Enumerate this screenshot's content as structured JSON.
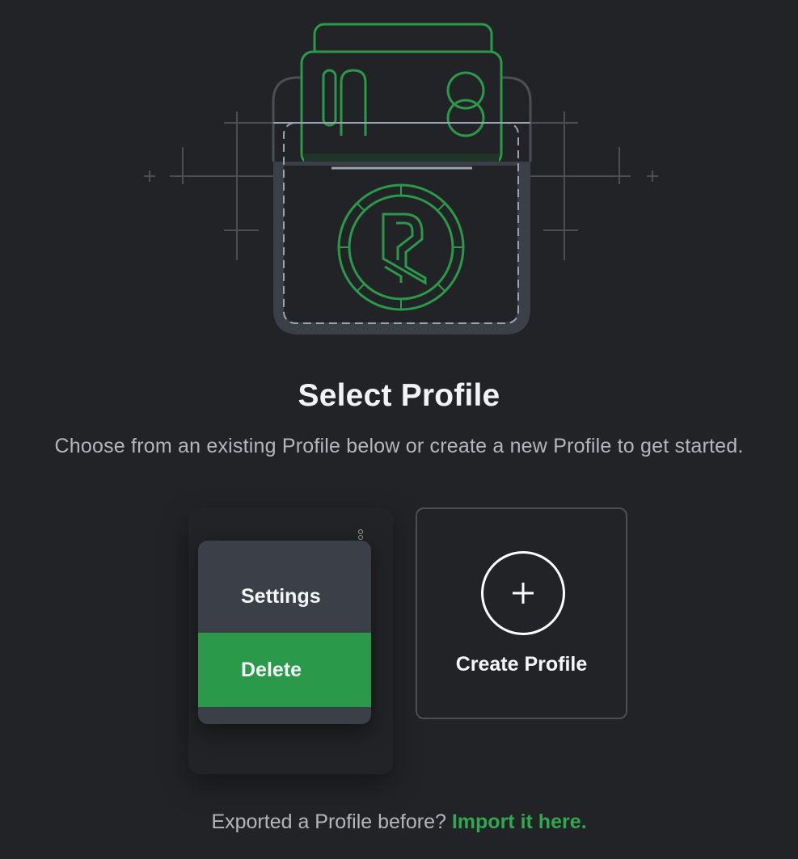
{
  "header": {
    "title": "Select Profile",
    "subtitle": "Choose from an existing Profile below or create a new Profile to get started."
  },
  "illustration": {
    "icon": "wallet-pocket-illustration"
  },
  "profile_menu": {
    "items": [
      {
        "label": "Settings"
      },
      {
        "label": "Delete"
      }
    ]
  },
  "create_profile": {
    "label": "Create Profile",
    "icon": "plus-icon"
  },
  "footer": {
    "text": "Exported a Profile before?",
    "link": "Import it here."
  },
  "colors": {
    "background": "#222326",
    "accent": "#2a9a4a",
    "menu": "#3b4048"
  }
}
